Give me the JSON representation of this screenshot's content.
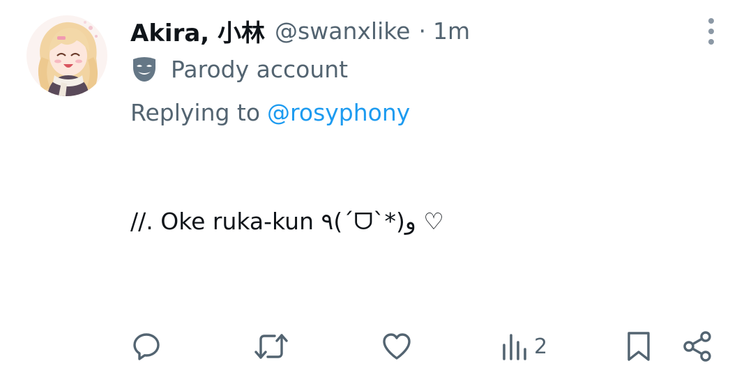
{
  "tweet": {
    "author": {
      "display_name": "Akira, 小林",
      "handle": "@swanxlike",
      "separator": "·",
      "time": "1m",
      "label": "Parody account"
    },
    "reply": {
      "prefix": "Replying to",
      "handle": "@rosyphony"
    },
    "text": "//. Oke ruka-kun ٩(´ᗜ`*)و ♡"
  },
  "actions": {
    "reply_icon": "comment-icon",
    "retweet_icon": "retweet-icon",
    "like_icon": "heart-icon",
    "views_icon": "bar-chart-icon",
    "views_count": "2",
    "bookmark_icon": "bookmark-icon",
    "share_icon": "share-icon"
  },
  "colors": {
    "text": "#0f1419",
    "secondary": "#536471",
    "link": "#1d9bf0"
  }
}
